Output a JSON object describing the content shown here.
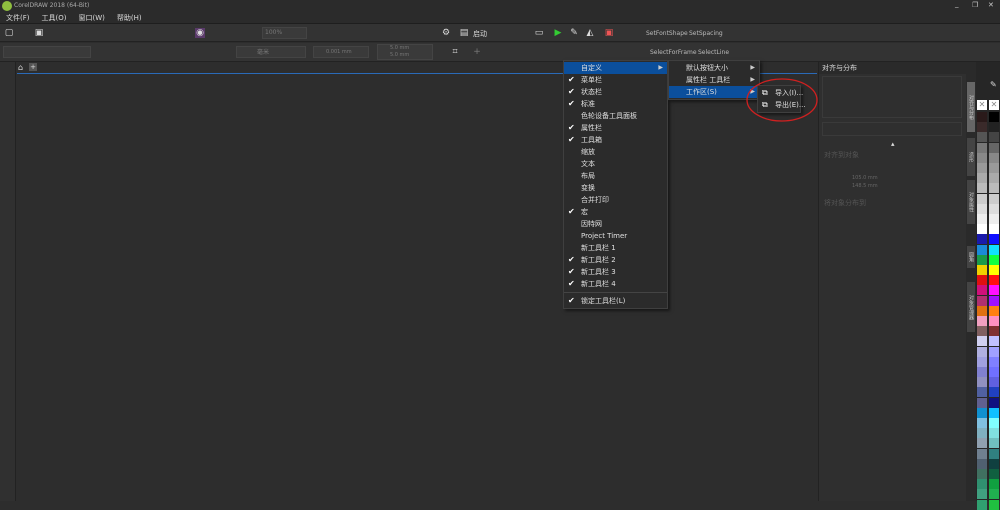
{
  "window": {
    "title": "CorelDRAW 2018 (64-Bit)"
  },
  "menubar": [
    "文件(F)",
    "工具(O)",
    "窗口(W)",
    "帮助(H)"
  ],
  "toolbar": {
    "zoom": "100%",
    "launch": "启动",
    "macros1": [
      "SetFontShape",
      "SetSpacing"
    ],
    "macros2": [
      "SelectForFrame",
      "SelectLine"
    ],
    "nudge": "0.001 mm",
    "size_w": "5.0 mm",
    "size_h": "5.0 mm",
    "unit": "毫米"
  },
  "panel": {
    "title": "对齐与分布",
    "section1": "对齐到对象",
    "section2": "将对象分布到",
    "x_value": "105.0 mm",
    "y_value": "148.5 mm",
    "vtabs": [
      "对齐与分布",
      "造形",
      "对象属性",
      "圆角",
      "对象管理器"
    ]
  },
  "menu": {
    "items": [
      {
        "label": "自定义",
        "checked": false,
        "submenu": true,
        "highlight": true
      },
      {
        "label": "菜单栏",
        "checked": true
      },
      {
        "label": "状态栏",
        "checked": true
      },
      {
        "label": "标准",
        "checked": true
      },
      {
        "label": "色轮设备工具面板",
        "checked": false
      },
      {
        "label": "属性栏",
        "checked": true
      },
      {
        "label": "工具箱",
        "checked": true
      },
      {
        "label": "缩放",
        "checked": false
      },
      {
        "label": "文本",
        "checked": false
      },
      {
        "label": "布局",
        "checked": false
      },
      {
        "label": "变换",
        "checked": false
      },
      {
        "label": "合并打印",
        "checked": false
      },
      {
        "label": "宏",
        "checked": true
      },
      {
        "label": "因特网",
        "checked": false
      },
      {
        "label": "Project Timer",
        "checked": false
      },
      {
        "label": "新工具栏 1",
        "checked": false
      },
      {
        "label": "新工具栏 2",
        "checked": true
      },
      {
        "label": "新工具栏 3",
        "checked": true
      },
      {
        "label": "新工具栏 4",
        "checked": true
      },
      {
        "sep": true
      },
      {
        "label": "锁定工具栏(L)",
        "checked": true
      }
    ]
  },
  "submenu1": {
    "items": [
      {
        "label": "默认按钮大小",
        "submenu": true
      },
      {
        "label": "属性栏 工具栏",
        "submenu": true
      },
      {
        "label": "工作区(S)",
        "submenu": true,
        "highlight": true
      }
    ]
  },
  "submenu2": {
    "items": [
      {
        "label": "导入(I)..."
      },
      {
        "label": "导出(E)..."
      }
    ]
  },
  "annotation_color": "#d02020",
  "palette": {
    "col1": [
      "#2a1a1a",
      "#3a2a2a",
      "#555555",
      "#777777",
      "#888888",
      "#999999",
      "#aaaaaa",
      "#bbbbbb",
      "#cccccc",
      "#dddddd",
      "#eeeeee",
      "#ffffff",
      "#1a1aaa",
      "#1a8ad8",
      "#1a9a4a",
      "#f0d000",
      "#e01010",
      "#d0107a",
      "#b03070",
      "#e07010",
      "#f0a0c0",
      "#806060",
      "#d0d0f0",
      "#b0b0e0",
      "#a0a0e0",
      "#8080d0",
      "#9090c0",
      "#5060a0",
      "#606090",
      "#1090d0",
      "#80c0e0",
      "#80b0c0",
      "#90a0b0",
      "#708090",
      "#506070",
      "#407060",
      "#309070",
      "#40a080",
      "#30a070"
    ],
    "col2": [
      "#000000",
      "#222222",
      "#444444",
      "#666666",
      "#888888",
      "#999999",
      "#aaaaaa",
      "#bbbbbb",
      "#cccccc",
      "#dddddd",
      "#eeeeee",
      "#ffffff",
      "#1010ff",
      "#10e0ff",
      "#10ff40",
      "#ffff00",
      "#ff1010",
      "#ff10ff",
      "#a010ff",
      "#ff8010",
      "#ff90c0",
      "#803030",
      "#c0c0ff",
      "#a0a0ff",
      "#8080ff",
      "#7070ff",
      "#6060e0",
      "#2040c0",
      "#101080",
      "#10c0ff",
      "#80ffff",
      "#80e0e0",
      "#70c0c0",
      "#308080",
      "#104040",
      "#106040",
      "#10a040",
      "#20b050",
      "#20c040"
    ]
  }
}
